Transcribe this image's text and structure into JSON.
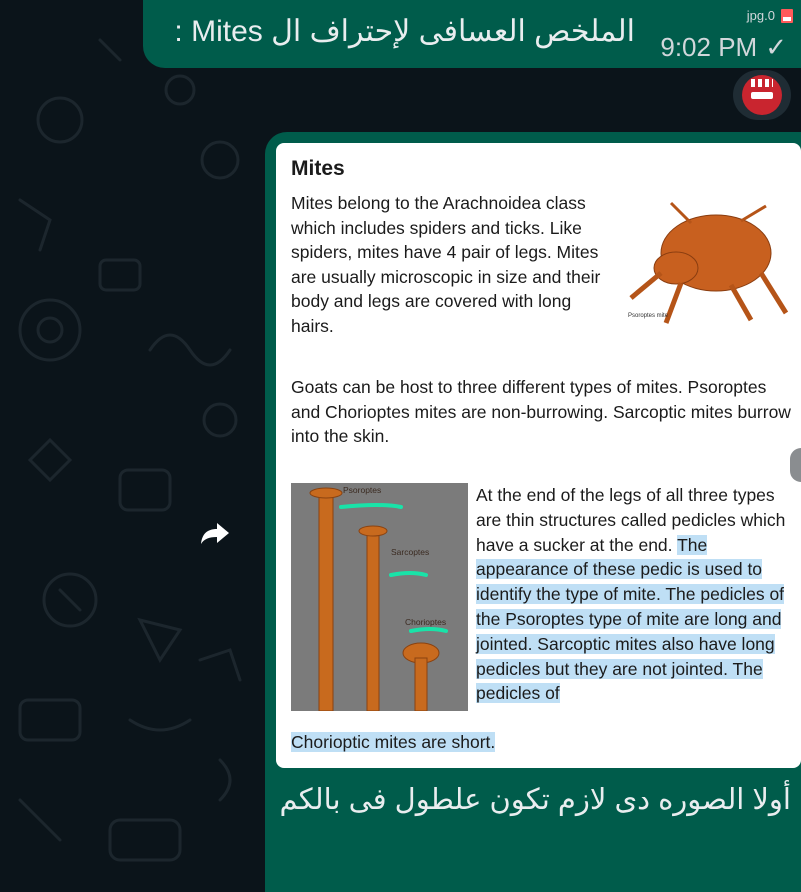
{
  "top_message": {
    "text": "الملخص العسافى لإحتراف ال Mites :",
    "attachment_name": "jpg.0",
    "time": "9:02 PM"
  },
  "image_message": {
    "card": {
      "title": "Mites",
      "paragraph1": "Mites belong to the Arachnoidea class which includes spiders and ticks. Like spiders, mites have 4 pair of legs. Mites are usually microscopic in size and their body and legs are covered with long hairs.",
      "mite_image_caption": "Psoroptes mite",
      "paragraph2": "Goats can be host to three different types of mites. Psoroptes and Chorioptes mites are non-burrowing. Sarcoptic mites burrow into the skin.",
      "pedicle_labels": [
        "Psoroptes",
        "Sarcoptes",
        "Chorioptes"
      ],
      "paragraph3_plain": "At the end of the legs of all three types are thin structures called pedicles which have a sucker at the end.",
      "paragraph3_highlight": "The appearance of these pedic   is used to identify the type of mite. The pedicles of the Psoroptes type of mite are long and jointed. Sarcoptic mites also have long pedicles but they are not jointed. The pedicles of",
      "paragraph3_tail": "Chorioptic mites are short."
    },
    "caption": "أولا الصوره دى لازم تكون علطول فى بالكم"
  },
  "colors": {
    "background": "#0b141a",
    "outgoing_bubble": "#005c4b",
    "highlight": "#bfdff5"
  },
  "icons": [
    "share-forward-icon",
    "double-check-icon",
    "file-icon",
    "emoji-avatar-icon"
  ]
}
